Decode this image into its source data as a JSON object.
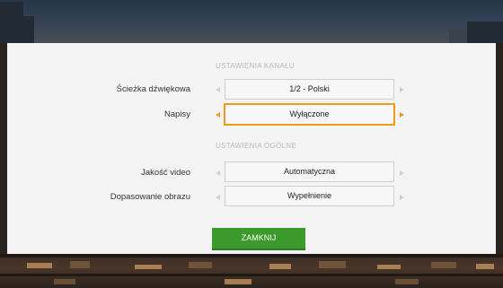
{
  "channel_section": {
    "title": "USTAWIENIA KANAŁU"
  },
  "general_section": {
    "title": "USTAWIENIA OGÓLNE"
  },
  "settings": [
    {
      "label": "Ścieżka dźwiękowa",
      "value": "1/2 - Polski",
      "active": false
    },
    {
      "label": "Napisy",
      "value": "Wyłączone",
      "active": true
    },
    {
      "label": "Jakość video",
      "value": "Automatyczna",
      "active": false
    },
    {
      "label": "Dopasowanie obrazu",
      "value": "Wypełnienie",
      "active": false
    }
  ],
  "close_button": {
    "label": "ZAMKNIJ"
  },
  "colors": {
    "accent": "#f39a1b",
    "button": "#3c9a2c",
    "panel": "#f4f4f4"
  },
  "icons": {
    "left": "chevron-left-icon",
    "right": "chevron-right-icon"
  }
}
